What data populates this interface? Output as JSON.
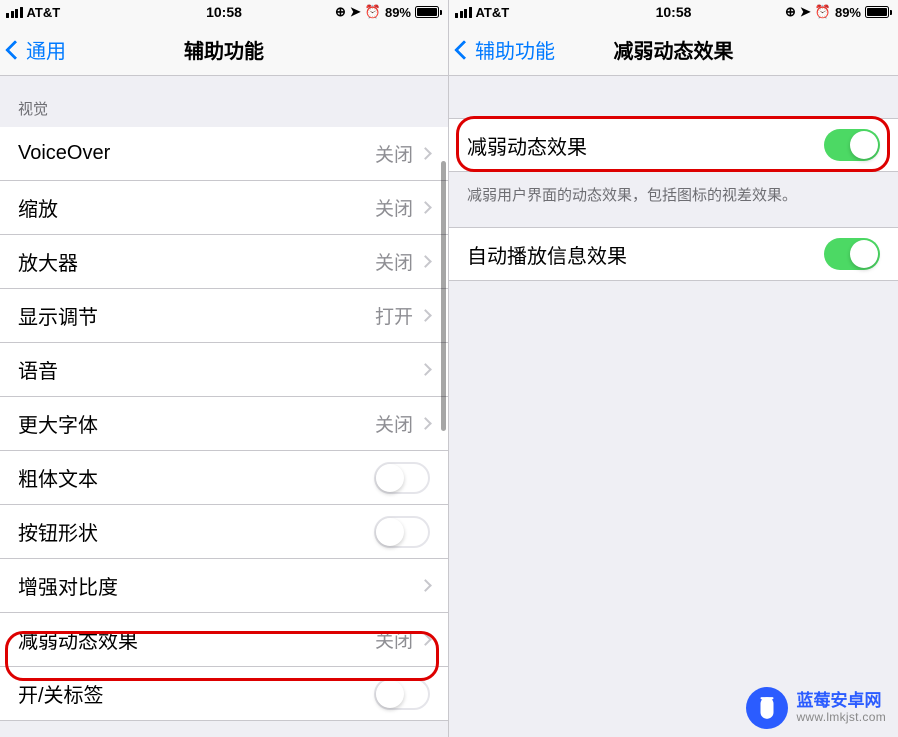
{
  "left": {
    "status": {
      "carrier": "AT&T",
      "time": "10:58",
      "battery": "89%"
    },
    "nav": {
      "back": "通用",
      "title": "辅助功能"
    },
    "section_header": "视觉",
    "rows": {
      "voiceover": {
        "label": "VoiceOver",
        "value": "关闭"
      },
      "zoom": {
        "label": "缩放",
        "value": "关闭"
      },
      "magnifier": {
        "label": "放大器",
        "value": "关闭"
      },
      "display": {
        "label": "显示调节",
        "value": "打开"
      },
      "speech": {
        "label": "语音",
        "value": ""
      },
      "larger": {
        "label": "更大字体",
        "value": "关闭"
      },
      "bold": {
        "label": "粗体文本"
      },
      "shapes": {
        "label": "按钮形状"
      },
      "contrast": {
        "label": "增强对比度",
        "value": ""
      },
      "reduce": {
        "label": "减弱动态效果",
        "value": "关闭"
      },
      "labels": {
        "label": "开/关标签"
      }
    }
  },
  "right": {
    "status": {
      "carrier": "AT&T",
      "time": "10:58",
      "battery": "89%"
    },
    "nav": {
      "back": "辅助功能",
      "title": "减弱动态效果"
    },
    "rows": {
      "reduce": {
        "label": "减弱动态效果"
      },
      "autoplay": {
        "label": "自动播放信息效果"
      }
    },
    "footer": "减弱用户界面的动态效果，包括图标的视差效果。"
  },
  "watermark": {
    "title": "蓝莓安卓网",
    "url": "www.lmkjst.com"
  }
}
